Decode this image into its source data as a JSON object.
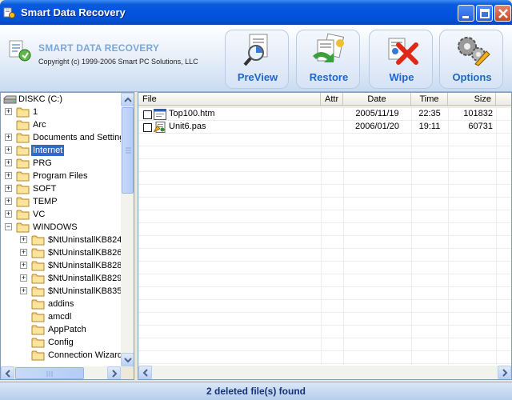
{
  "window": {
    "title": "Smart Data Recovery"
  },
  "header": {
    "brand": "SMART DATA RECOVERY",
    "copyright": "Copyright (c) 1999-2006 Smart PC Solutions, LLC"
  },
  "toolbar": {
    "preview_label": "PreView",
    "restore_label": "Restore",
    "wipe_label": "Wipe",
    "options_label": "Options"
  },
  "tree": {
    "drive": "DISKC (C:)",
    "selected": "Internet",
    "items": [
      {
        "label": "1",
        "expander": "+"
      },
      {
        "label": "Arc",
        "expander": ""
      },
      {
        "label": "Documents and Settings",
        "expander": "+"
      },
      {
        "label": "Internet",
        "expander": "+"
      },
      {
        "label": "PRG",
        "expander": "+"
      },
      {
        "label": "Program Files",
        "expander": "+"
      },
      {
        "label": "SOFT",
        "expander": "+"
      },
      {
        "label": "TEMP",
        "expander": "+"
      },
      {
        "label": "VC",
        "expander": "+"
      },
      {
        "label": "WINDOWS",
        "expander": "−"
      },
      {
        "label": "$NtUninstallKB824",
        "expander": "+"
      },
      {
        "label": "$NtUninstallKB826",
        "expander": "+"
      },
      {
        "label": "$NtUninstallKB828",
        "expander": "+"
      },
      {
        "label": "$NtUninstallKB829",
        "expander": "+"
      },
      {
        "label": "$NtUninstallKB835",
        "expander": "+"
      },
      {
        "label": "addins",
        "expander": ""
      },
      {
        "label": "amcdl",
        "expander": ""
      },
      {
        "label": "AppPatch",
        "expander": ""
      },
      {
        "label": "Config",
        "expander": ""
      },
      {
        "label": "Connection Wizard",
        "expander": ""
      }
    ]
  },
  "list": {
    "columns": {
      "file": "File",
      "attr": "Attr",
      "date": "Date",
      "time": "Time",
      "size": "Size"
    },
    "rows": [
      {
        "name": "Top100.htm",
        "attr": "",
        "date": "2005/11/19",
        "time": "22:35",
        "size": "101832",
        "icon": "html-file-icon"
      },
      {
        "name": "Unit6.pas",
        "attr": "",
        "date": "2006/01/20",
        "time": "19:11",
        "size": "60731",
        "icon": "pascal-file-icon"
      }
    ]
  },
  "status": {
    "text": "2 deleted file(s) found"
  },
  "colors": {
    "titlebar": "#0353e0",
    "selection": "#316ac5",
    "accent": "#1e67c8"
  }
}
